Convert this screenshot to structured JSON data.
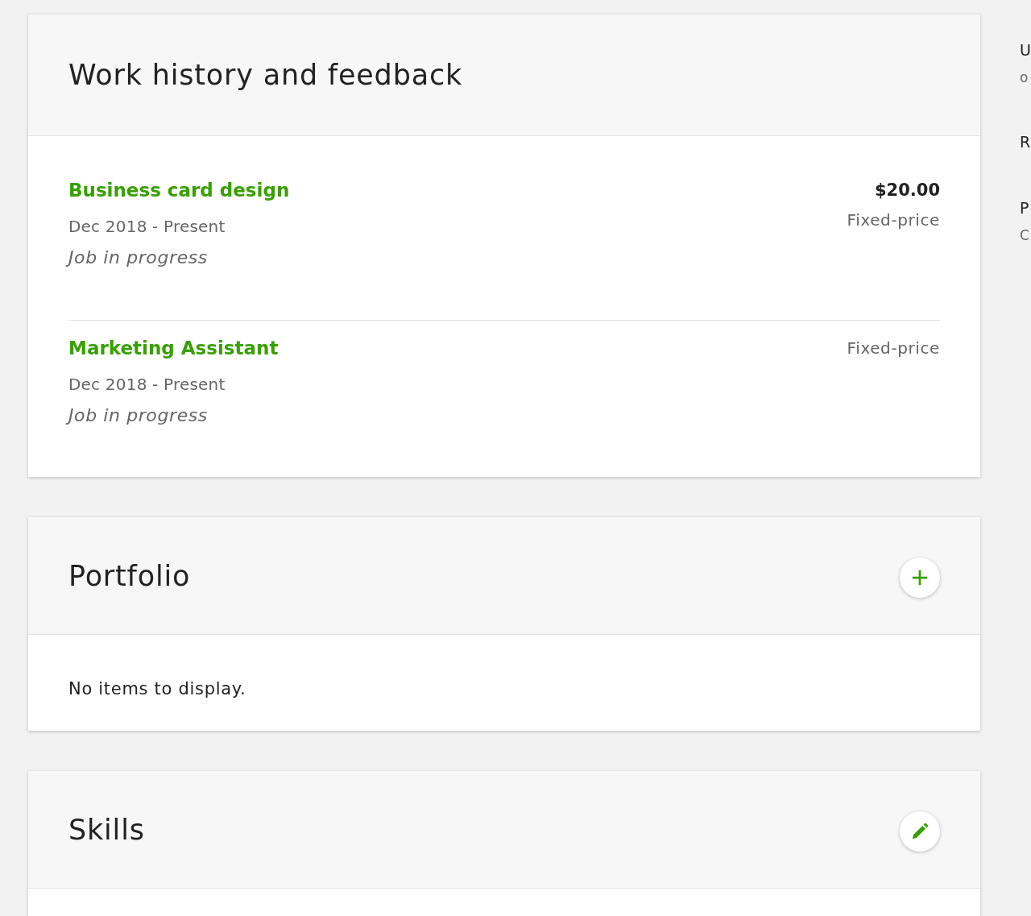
{
  "sections": [
    {
      "kind": "work_history",
      "title": "Work history and feedback",
      "jobs": [
        {
          "title": "Business card design",
          "dates": "Dec 2018 - Present",
          "status": "Job in progress",
          "amount": "$20.00",
          "price_type": "Fixed-price"
        },
        {
          "title": "Marketing Assistant",
          "dates": "Dec 2018 - Present",
          "status": "Job in progress",
          "price_type": "Fixed-price"
        }
      ]
    },
    {
      "kind": "portfolio",
      "title": "Portfolio",
      "button": {
        "kind": "add"
      },
      "empty_message": "No items to display."
    },
    {
      "kind": "skills",
      "title": "Skills",
      "button": {
        "kind": "edit"
      }
    }
  ],
  "right_column": [
    {
      "heading": "U",
      "detail": "o"
    },
    {
      "heading": "R"
    },
    {
      "heading": "P",
      "detail": "C"
    }
  ]
}
